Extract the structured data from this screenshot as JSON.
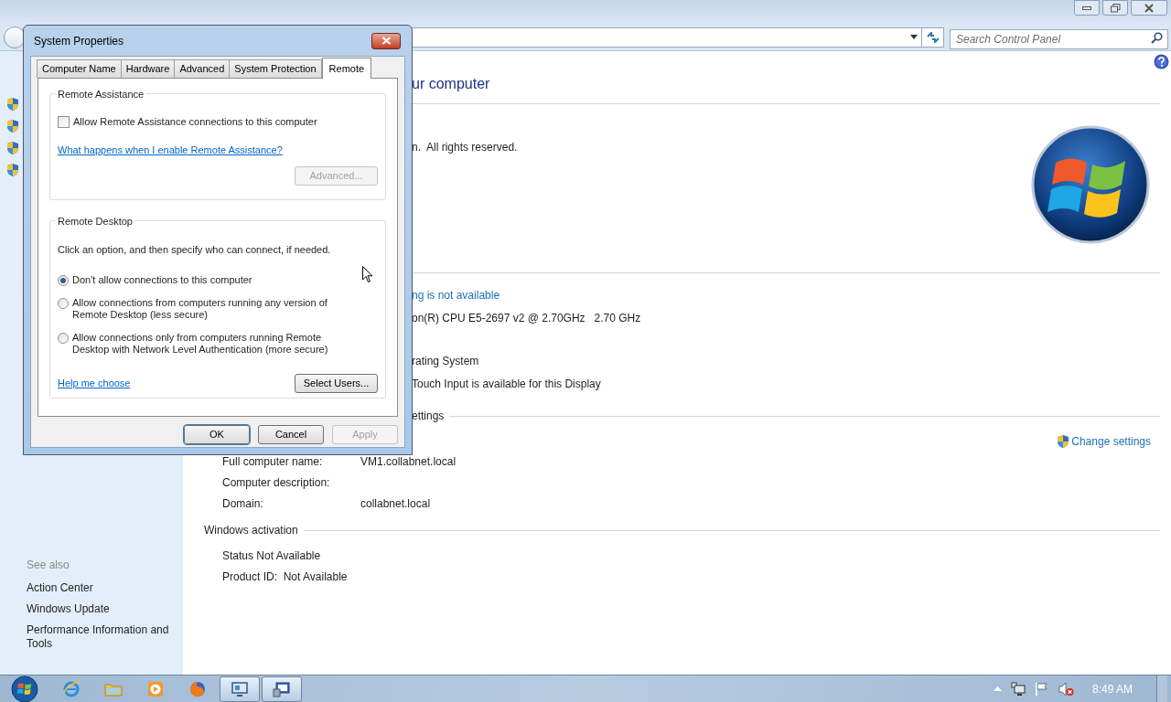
{
  "address_bar": {
    "search_placeholder": "Search Control Panel"
  },
  "see_also": {
    "heading": "See also",
    "links": [
      "Action Center",
      "Windows Update",
      "Performance Information and Tools"
    ]
  },
  "main": {
    "heading_fragment": "ur computer",
    "copyright_fragment": "n.  All rights reserved.",
    "rating_link_fragment": "ng is not available",
    "processor_fragment": "on(R) CPU E5-2697 v2 @ 2.70GHz   2.70 GHz",
    "system_type_fragment": "rating System",
    "pen_touch_fragment": "Touch Input is available for this Display",
    "section_fragment": "ettings",
    "change_settings": "Change settings",
    "computer_rows": [
      {
        "label": "Full computer name:",
        "value": "VM1.collabnet.local"
      },
      {
        "label": "Computer description:"
      },
      {
        "label": "Domain:",
        "value": "collabnet.local"
      }
    ],
    "activation": {
      "heading": "Windows activation",
      "lines": [
        "Status Not Available",
        "Product ID:  Not Available"
      ]
    }
  },
  "dialog": {
    "title": "System Properties",
    "tabs": [
      {
        "label": "Computer Name",
        "selected": false
      },
      {
        "label": "Hardware",
        "selected": false
      },
      {
        "label": "Advanced",
        "selected": false
      },
      {
        "label": "System Protection",
        "selected": false
      },
      {
        "label": "Remote",
        "selected": true
      }
    ],
    "remote_assistance": {
      "legend": "Remote Assistance",
      "checkbox": {
        "label": "Allow Remote Assistance connections to this computer",
        "checked": false
      },
      "link": "What happens when I enable Remote Assistance?",
      "advanced_button": {
        "label": "Advanced...",
        "disabled": true
      }
    },
    "remote_desktop": {
      "legend": "Remote Desktop",
      "instruction": "Click an option, and then specify who can connect, if needed.",
      "options": [
        {
          "lines": [
            "Don't allow connections to this computer"
          ],
          "selected": true
        },
        {
          "lines": [
            "Allow connections from computers running any version of",
            "Remote Desktop (less secure)"
          ],
          "selected": false
        },
        {
          "lines": [
            "Allow connections only from computers running Remote",
            "Desktop with Network Level Authentication (more secure)"
          ],
          "selected": false
        }
      ],
      "help_link": "Help me choose",
      "select_users_button": {
        "label": "Select Users...",
        "disabled": false
      }
    },
    "buttons": [
      {
        "label": "OK",
        "default": true,
        "disabled": false
      },
      {
        "label": "Cancel",
        "default": false,
        "disabled": false
      },
      {
        "label": "Apply",
        "default": false,
        "disabled": true
      }
    ]
  },
  "taskbar": {
    "apps": [
      {
        "kind": "browser",
        "running": false
      },
      {
        "kind": "folder",
        "running": false
      },
      {
        "kind": "media",
        "running": false
      },
      {
        "kind": "fox",
        "running": false
      },
      {
        "kind": "system",
        "running": true
      },
      {
        "kind": "remote",
        "running": true
      }
    ],
    "clock": "8:49 AM"
  }
}
